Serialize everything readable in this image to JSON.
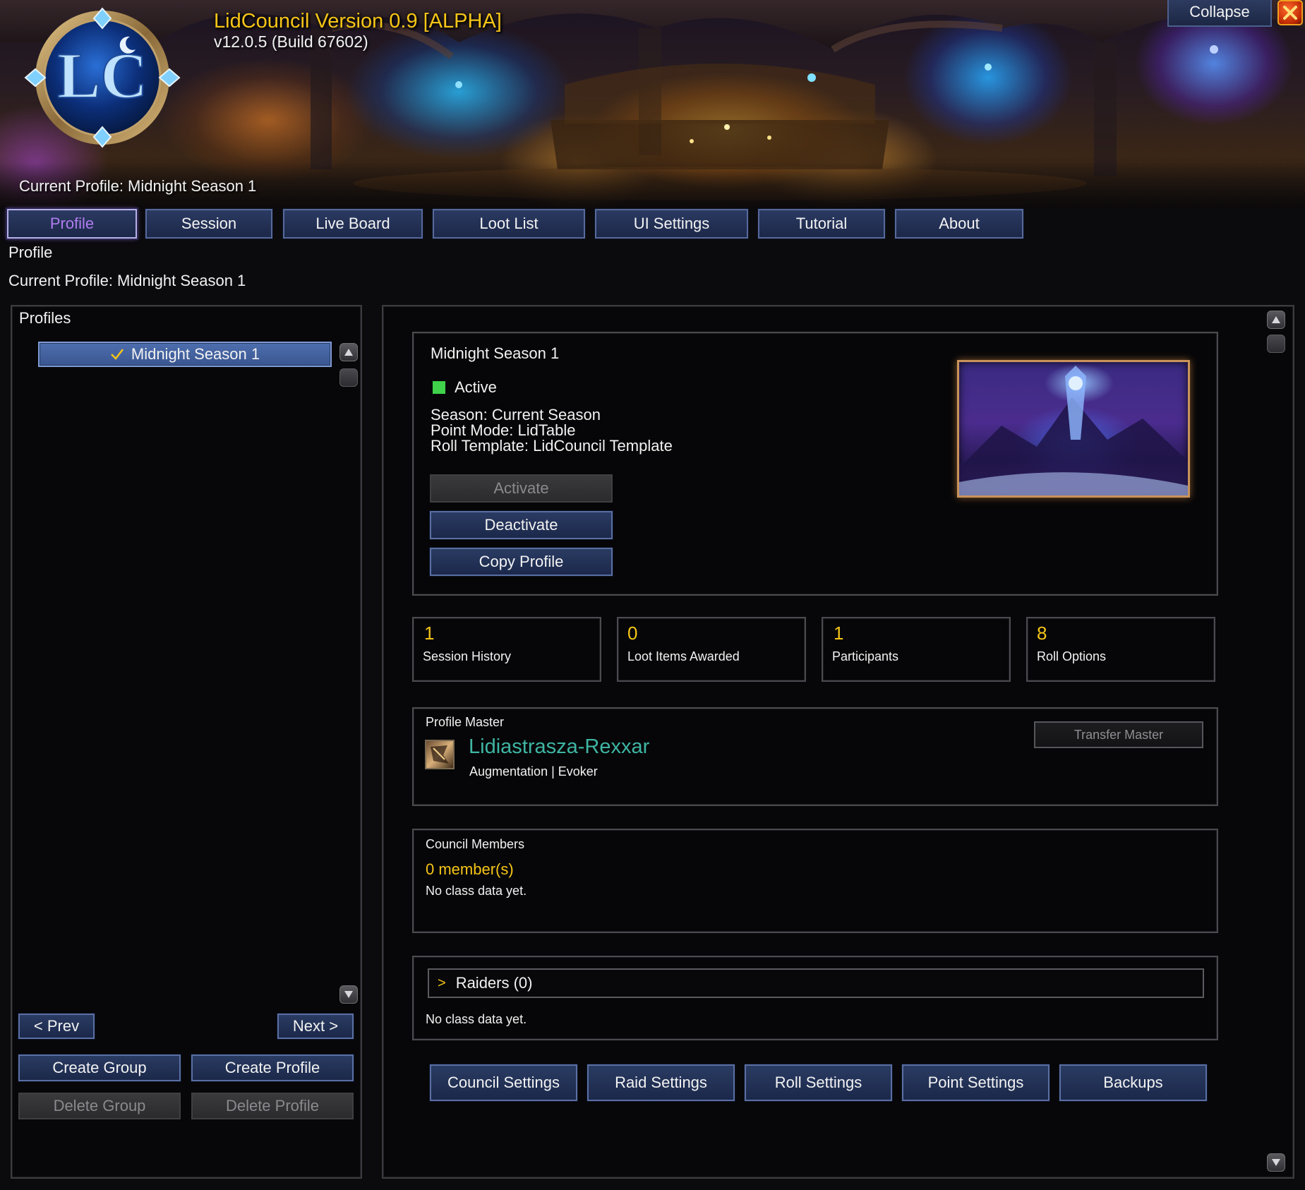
{
  "app": {
    "title": "LidCouncil Version 0.9 [ALPHA]",
    "build": "v12.0.5 (Build 67602)",
    "logo_text": "LC",
    "banner_profile": "Current Profile: Midnight Season 1",
    "collapse_label": "Collapse",
    "close_icon": "close-icon"
  },
  "tabs": [
    {
      "label": "Profile",
      "active": true
    },
    {
      "label": "Session"
    },
    {
      "label": "Live Board"
    },
    {
      "label": "Loot List"
    },
    {
      "label": "UI Settings"
    },
    {
      "label": "Tutorial"
    },
    {
      "label": "About"
    }
  ],
  "page": {
    "title": "Profile",
    "current_profile": "Current Profile: Midnight Season 1"
  },
  "profiles_panel": {
    "heading": "Profiles",
    "items": [
      {
        "label": "Midnight Season 1",
        "selected": true,
        "icon": "checkmark-icon"
      }
    ],
    "prev_label": "< Prev",
    "next_label": "Next >",
    "create_group_label": "Create Group",
    "create_profile_label": "Create Profile",
    "delete_group_label": "Delete Group",
    "delete_profile_label": "Delete Profile"
  },
  "profile_card": {
    "name": "Midnight Season 1",
    "status": "Active",
    "status_color": "#3fd24a",
    "season": "Season: Current Season",
    "point_mode": "Point Mode: LidTable",
    "roll_template": "Roll Template: LidCouncil Template",
    "activate_label": "Activate",
    "deactivate_label": "Deactivate",
    "copy_label": "Copy Profile"
  },
  "stats": [
    {
      "value": "1",
      "label": "Session History"
    },
    {
      "value": "0",
      "label": "Loot Items Awarded"
    },
    {
      "value": "1",
      "label": "Participants"
    },
    {
      "value": "8",
      "label": "Roll Options"
    }
  ],
  "master": {
    "heading": "Profile Master",
    "name": "Lidiastrasza-Rexxar",
    "spec": "Augmentation | Evoker",
    "name_color": "#3fb5a2",
    "transfer_label": "Transfer Master"
  },
  "council": {
    "heading": "Council Members",
    "count": "0 member(s)",
    "note": "No class data yet."
  },
  "raiders": {
    "arrow": ">",
    "label": "Raiders (0)",
    "note": "No class data yet."
  },
  "bottom_buttons": [
    {
      "label": "Council Settings"
    },
    {
      "label": "Raid Settings"
    },
    {
      "label": "Roll Settings"
    },
    {
      "label": "Point Settings"
    },
    {
      "label": "Backups"
    }
  ],
  "colors": {
    "accent_gold": "#f5c518",
    "button_blue": "#2a3b62",
    "active_tab_text": "#b17cf0"
  }
}
